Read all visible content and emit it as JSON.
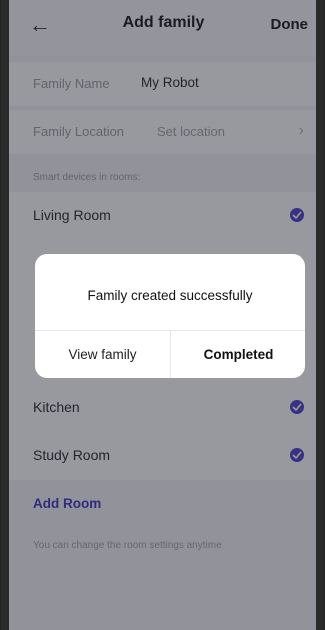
{
  "header": {
    "title": "Add family",
    "done_label": "Done"
  },
  "form": {
    "name_label": "Family Name",
    "name_value": "My Robot",
    "location_label": "Family Location",
    "location_value": "Set location"
  },
  "rooms_section": {
    "caption": "Smart devices in rooms:",
    "rooms": [
      {
        "label": "Living Room",
        "checked": true
      },
      {
        "label": "",
        "checked": true
      },
      {
        "label": "",
        "checked": true
      },
      {
        "label": "",
        "checked": true
      },
      {
        "label": "Kitchen",
        "checked": true
      },
      {
        "label": "Study Room",
        "checked": true
      }
    ],
    "add_room_label": "Add Room",
    "footer_note": "You can change the room settings anytime"
  },
  "dialog": {
    "message": "Family created successfully",
    "left_button": "View family",
    "right_button": "Completed"
  },
  "colors": {
    "accent": "#4b3cc6",
    "link": "#3b2ec2",
    "overlay": "#282837"
  }
}
